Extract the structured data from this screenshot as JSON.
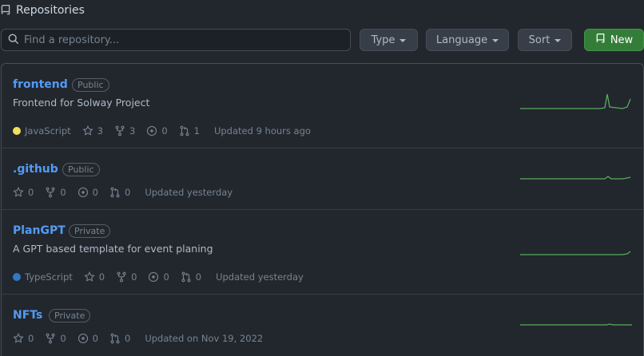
{
  "header": {
    "title": "Repositories"
  },
  "search": {
    "placeholder": "Find a repository..."
  },
  "filters": {
    "type_label": "Type",
    "language_label": "Language",
    "sort_label": "Sort",
    "new_label": "New"
  },
  "repos": [
    {
      "name": "frontend",
      "visibility": "Public",
      "description": "Frontend for Solway Project",
      "language": "JavaScript",
      "language_color": "#f1e05a",
      "stars": "3",
      "forks": "3",
      "issues": "0",
      "pulls": "1",
      "updated": "Updated 9 hours ago"
    },
    {
      "name": ".github",
      "visibility": "Public",
      "description": "",
      "language": "",
      "stars": "0",
      "forks": "0",
      "issues": "0",
      "pulls": "0",
      "updated": "Updated yesterday"
    },
    {
      "name": "PlanGPT",
      "visibility": "Private",
      "description": "A GPT based template for event planing",
      "language": "TypeScript",
      "language_color": "#3178c6",
      "stars": "0",
      "forks": "0",
      "issues": "0",
      "pulls": "0",
      "updated": "Updated yesterday"
    },
    {
      "name": "NFTs",
      "visibility": "Private",
      "description": "",
      "language": "",
      "stars": "0",
      "forks": "0",
      "issues": "0",
      "pulls": "0",
      "updated": "Updated on Nov 19, 2022"
    }
  ],
  "colors": {
    "accent_link": "#539bf5",
    "new_button": "#347d39",
    "sparkline": "#57ab5a"
  }
}
